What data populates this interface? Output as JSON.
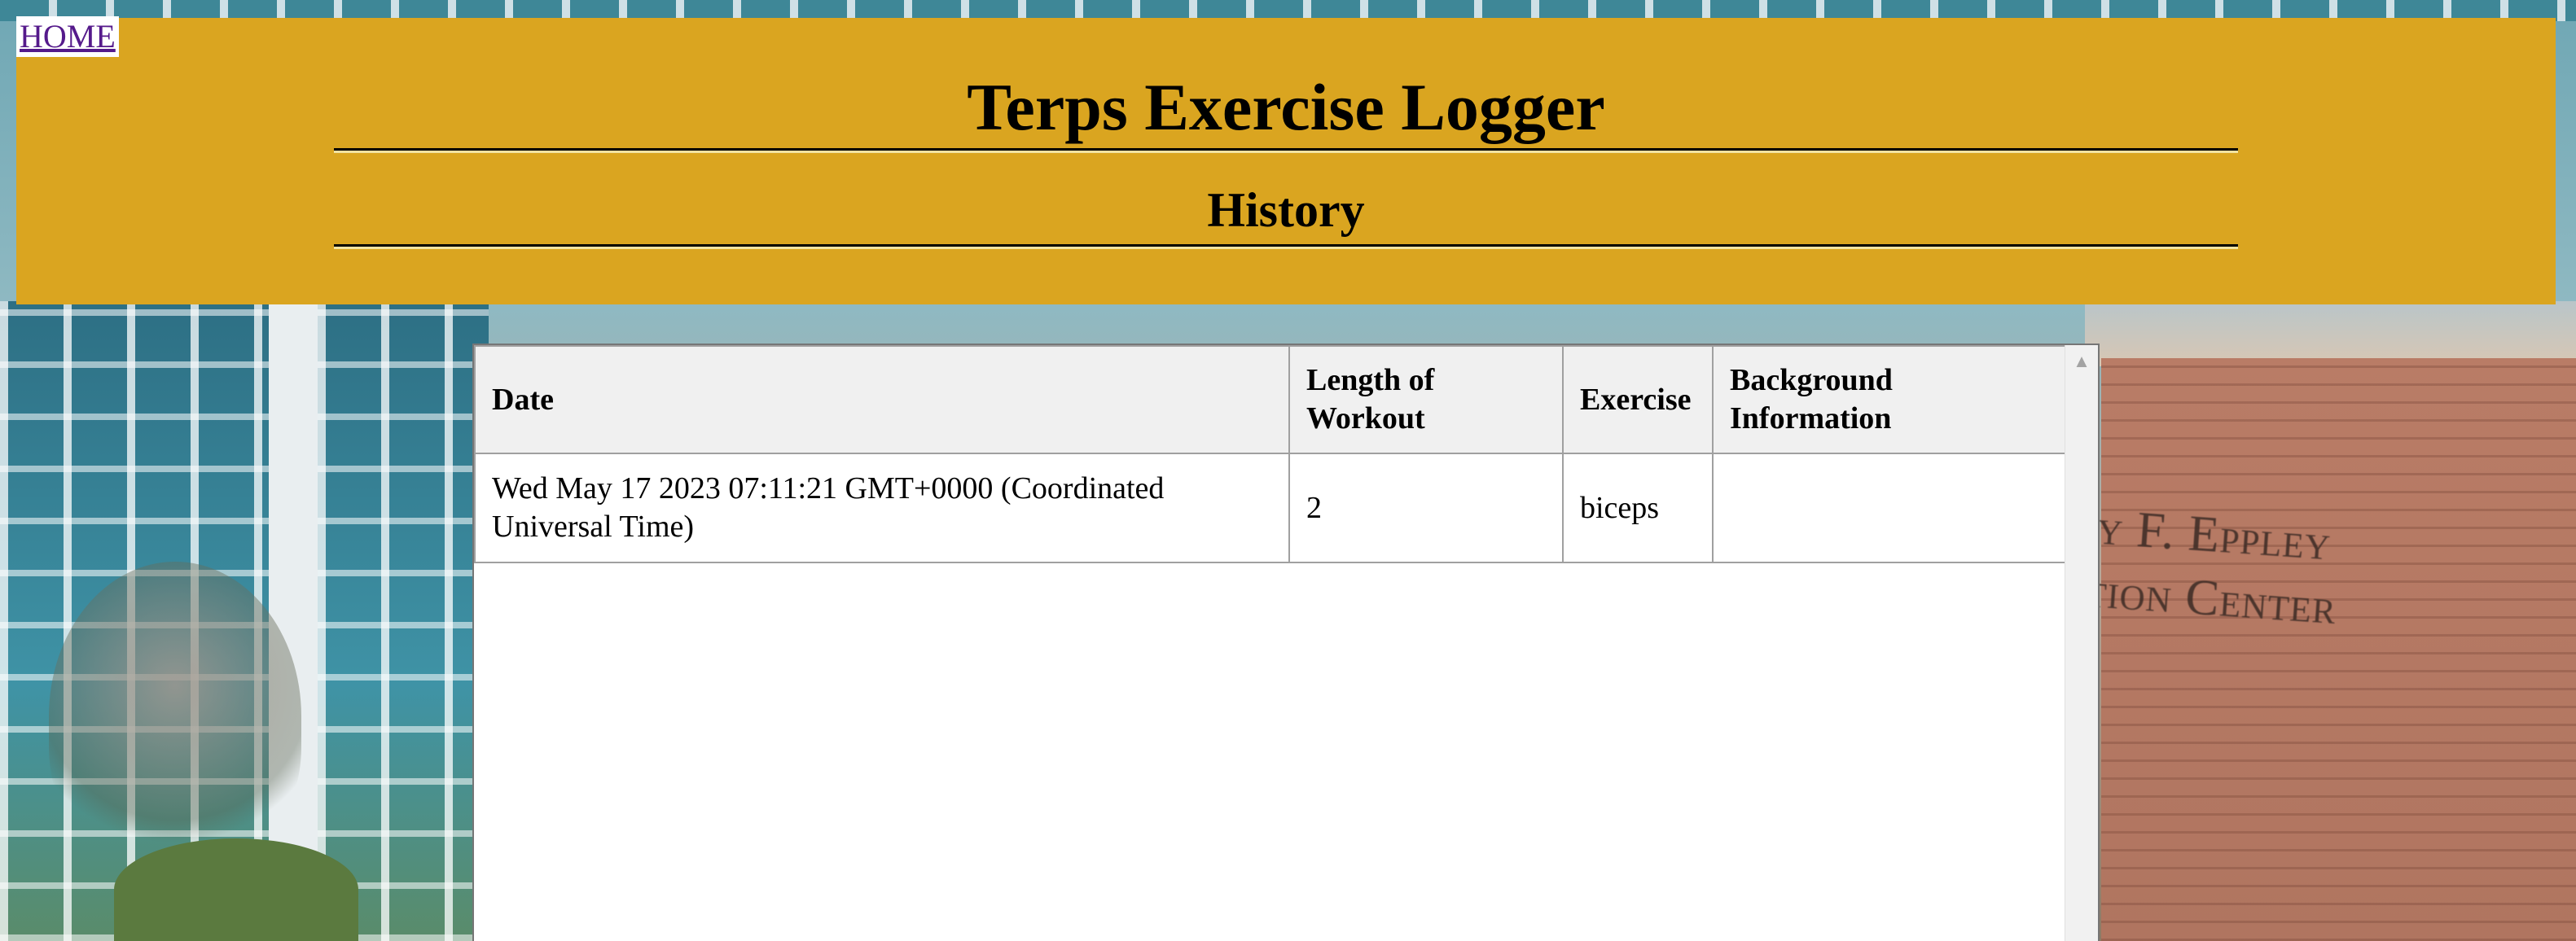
{
  "nav": {
    "home_label": "HOME"
  },
  "header": {
    "title": "Terps Exercise Logger",
    "subtitle": "History"
  },
  "background": {
    "sign_line1": "y F. Eppley",
    "sign_line2": "tion Center"
  },
  "table": {
    "columns": [
      "Date",
      "Length of Workout",
      "Exercise",
      "Background Information"
    ],
    "rows": [
      {
        "date": "Wed May 17 2023 07:11:21 GMT+0000 (Coordinated Universal Time)",
        "length": "2",
        "exercise": "biceps",
        "background": ""
      }
    ]
  },
  "colors": {
    "banner": "#daa520",
    "link": "#551a8b"
  },
  "icons": {
    "scroll_up": "scroll-up-arrow-icon"
  }
}
